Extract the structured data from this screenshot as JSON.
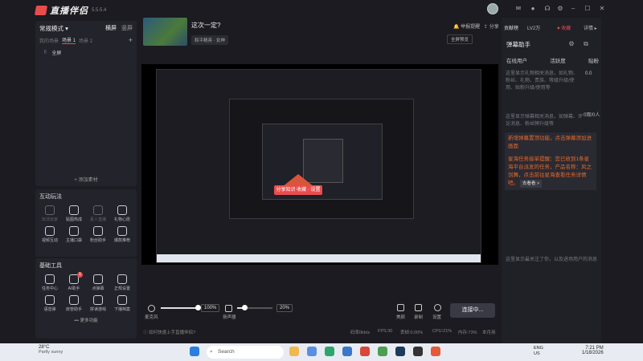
{
  "app": {
    "name": "直播伴侣",
    "version": "5.5.5.4"
  },
  "titlebar": {
    "complaint": "举报提醒",
    "share": "分享",
    "star": "收藏",
    "rank": "LV2万",
    "detail": "详情"
  },
  "left_panel": {
    "mode_title": "常规模式",
    "mode_tabs": [
      "横屏",
      "竖屏"
    ],
    "scene_label": "我的场景",
    "scenes": [
      "场景 1",
      "场景 2"
    ],
    "source": "全屏",
    "add_source": "添加素材"
  },
  "interactive": {
    "title": "互动玩法",
    "items": [
      {
        "label": "玩法玩家",
        "dim": true
      },
      {
        "label": "贴图热成",
        "dim": false
      },
      {
        "label": "素人直播",
        "dim": true
      },
      {
        "label": "礼物心愿",
        "dim": false
      },
      {
        "label": "视频互动",
        "dim": false
      },
      {
        "label": "主播口袋",
        "dim": false
      },
      {
        "label": "粉丝助手",
        "dim": false
      },
      {
        "label": "爆款推荐",
        "dim": false
      }
    ]
  },
  "tools": {
    "title": "基础工具",
    "items": [
      {
        "label": "任务中心",
        "badge": ""
      },
      {
        "label": "AI助手",
        "badge": "1"
      },
      {
        "label": "点弹幕",
        "badge": ""
      },
      {
        "label": "正规设置",
        "badge": ""
      },
      {
        "label": "语音弹",
        "badge": ""
      },
      {
        "label": "房管助手",
        "badge": ""
      },
      {
        "label": "拼读游戏",
        "badge": ""
      },
      {
        "label": "下播档案",
        "badge": ""
      }
    ],
    "more": "更多功能"
  },
  "stream": {
    "title": "这次一定?",
    "category": "和平精英 · 女神",
    "fullscreen": "全屏预览"
  },
  "preview": {
    "popup": "分享知识 收藏 · 设置"
  },
  "controls": {
    "mic_label": "麦克风",
    "mic_pct": "100%",
    "mic_level": 1.0,
    "speaker_label": "扬声器",
    "speaker_pct": "20%",
    "speaker_level": 0.2,
    "effects": "美颜",
    "record": "录制",
    "settings": "设置",
    "connect": "连接中..."
  },
  "status": {
    "help": "如何快速上手直播伴侣?",
    "bitrate": "码率0kb/s",
    "fps": "FPS:30",
    "dropped": "丢帧:0.00%",
    "cpu": "CPU:21%",
    "mem": "内存:73%",
    "usage": "本月用"
  },
  "right_panel": {
    "hdr_contrib": "贡献榜",
    "hdr_count": "0.0",
    "title": "弹幕助手",
    "tabs": [
      "在线用户",
      "活跃度",
      "贴粉"
    ],
    "text1": "这里显示礼物相关消息，如礼物、粉丝、礼物、贵族、等级升级/使用、贴粉升级/使用等",
    "text2": "这里显示弹幕相关消息，如弹幕、评论消息、粉丝牌升级等",
    "counter": "0观/0人",
    "notice1": "新增弹幕置顶功能，点击弹幕添加进画面",
    "notice2": "星海任务接单提醒：您已收到1条星海平台派发的任务，产品名称：风之剑舞，点击前往星海查看任务详情吧。",
    "notice_more": "去看看 >",
    "text3": "这里显示最关注了你，以及进场用户的消息"
  },
  "taskbar": {
    "temp": "28°C",
    "weather": "Partly sunny",
    "search": "Search",
    "lang1": "ENG",
    "lang2": "US",
    "time": "7:21 PM",
    "date": "1/18/2026"
  }
}
